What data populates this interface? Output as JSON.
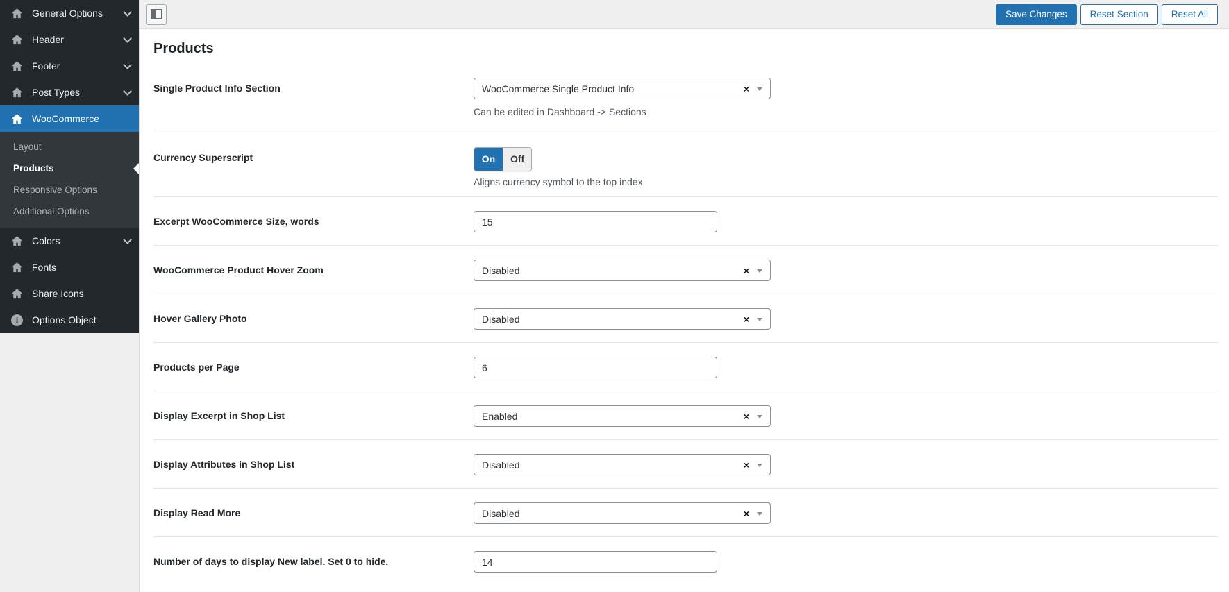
{
  "colors": {
    "accent": "#2271b1",
    "sidebar_bg": "#23282d",
    "submenu_bg": "#32373c",
    "page_bg": "#f0f0f1",
    "content_bg": "#ffffff",
    "helper_text": "#50575e"
  },
  "sidebar": {
    "items": [
      {
        "label": "General Options",
        "icon": "home-icon",
        "chevron": true
      },
      {
        "label": "Header",
        "icon": "home-icon",
        "chevron": true
      },
      {
        "label": "Footer",
        "icon": "home-icon",
        "chevron": true
      },
      {
        "label": "Post Types",
        "icon": "home-icon",
        "chevron": true
      },
      {
        "label": "WooCommerce",
        "icon": "home-icon",
        "chevron": false,
        "active": true,
        "submenu": [
          {
            "label": "Layout",
            "active": false
          },
          {
            "label": "Products",
            "active": true
          },
          {
            "label": "Responsive Options",
            "active": false
          },
          {
            "label": "Additional Options",
            "active": false
          }
        ]
      },
      {
        "label": "Colors",
        "icon": "home-icon",
        "chevron": true
      },
      {
        "label": "Fonts",
        "icon": "home-icon",
        "chevron": false
      },
      {
        "label": "Share Icons",
        "icon": "home-icon",
        "chevron": false
      },
      {
        "label": "Options Object",
        "icon": "info-icon",
        "chevron": false
      }
    ]
  },
  "topbar": {
    "collapse_icon": "layout-collapse-icon",
    "buttons": [
      {
        "label": "Save Changes",
        "variant": "primary"
      },
      {
        "label": "Reset Section",
        "variant": "secondary"
      },
      {
        "label": "Reset All",
        "variant": "secondary"
      }
    ]
  },
  "page": {
    "title": "Products"
  },
  "form": {
    "rows": [
      {
        "label": "Single Product Info Section",
        "type": "select",
        "value": "WooCommerce Single Product Info",
        "helper": "Can be edited in Dashboard -> Sections"
      },
      {
        "label": "Currency Superscript",
        "type": "toggle",
        "options": [
          "On",
          "Off"
        ],
        "value": "On",
        "helper": "Aligns currency symbol to the top index"
      },
      {
        "label": "Excerpt WooCommerce Size, words",
        "type": "input",
        "value": "15"
      },
      {
        "label": "WooCommerce Product Hover Zoom",
        "type": "select",
        "value": "Disabled"
      },
      {
        "label": "Hover Gallery Photo",
        "type": "select",
        "value": "Disabled"
      },
      {
        "label": "Products per Page",
        "type": "input",
        "value": "6"
      },
      {
        "label": "Display Excerpt in Shop List",
        "type": "select",
        "value": "Enabled"
      },
      {
        "label": "Display Attributes in Shop List",
        "type": "select",
        "value": "Disabled"
      },
      {
        "label": "Display Read More",
        "type": "select",
        "value": "Disabled"
      },
      {
        "label": "Number of days to display New label. Set 0 to hide.",
        "type": "input",
        "value": "14"
      }
    ]
  }
}
